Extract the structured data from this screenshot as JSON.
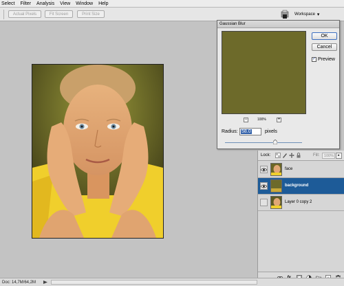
{
  "menubar": {
    "items": [
      "Select",
      "Filter",
      "Analysis",
      "View",
      "Window",
      "Help"
    ]
  },
  "options_bar": {
    "actual_pixels": "Actual Pixels",
    "fit_screen": "Fit Screen",
    "print_size": "Print Size",
    "workspace": "Workspace"
  },
  "canvas": {
    "background_color": "#c3c3c3"
  },
  "gaussian_blur": {
    "title": "Gaussian Blur",
    "ok_label": "OK",
    "cancel_label": "Cancel",
    "preview_label": "Preview",
    "preview_checked": true,
    "zoom": "100%",
    "radius_label": "Radius:",
    "radius_value": "58.0",
    "radius_unit": "pixels",
    "preview_color": "#6d6a2a"
  },
  "layers": {
    "lock_label": "Lock:",
    "fill_label": "Fill:",
    "fill_value": "100%",
    "items": [
      {
        "name": "face",
        "visible": true,
        "selected": false
      },
      {
        "name": "background",
        "visible": true,
        "selected": true
      },
      {
        "name": "Layer 0 copy 2",
        "visible": false,
        "selected": false
      }
    ],
    "selected_color": "#1d5b98"
  },
  "status": {
    "doc_size": "Doc: 14,7M/64,2M"
  }
}
